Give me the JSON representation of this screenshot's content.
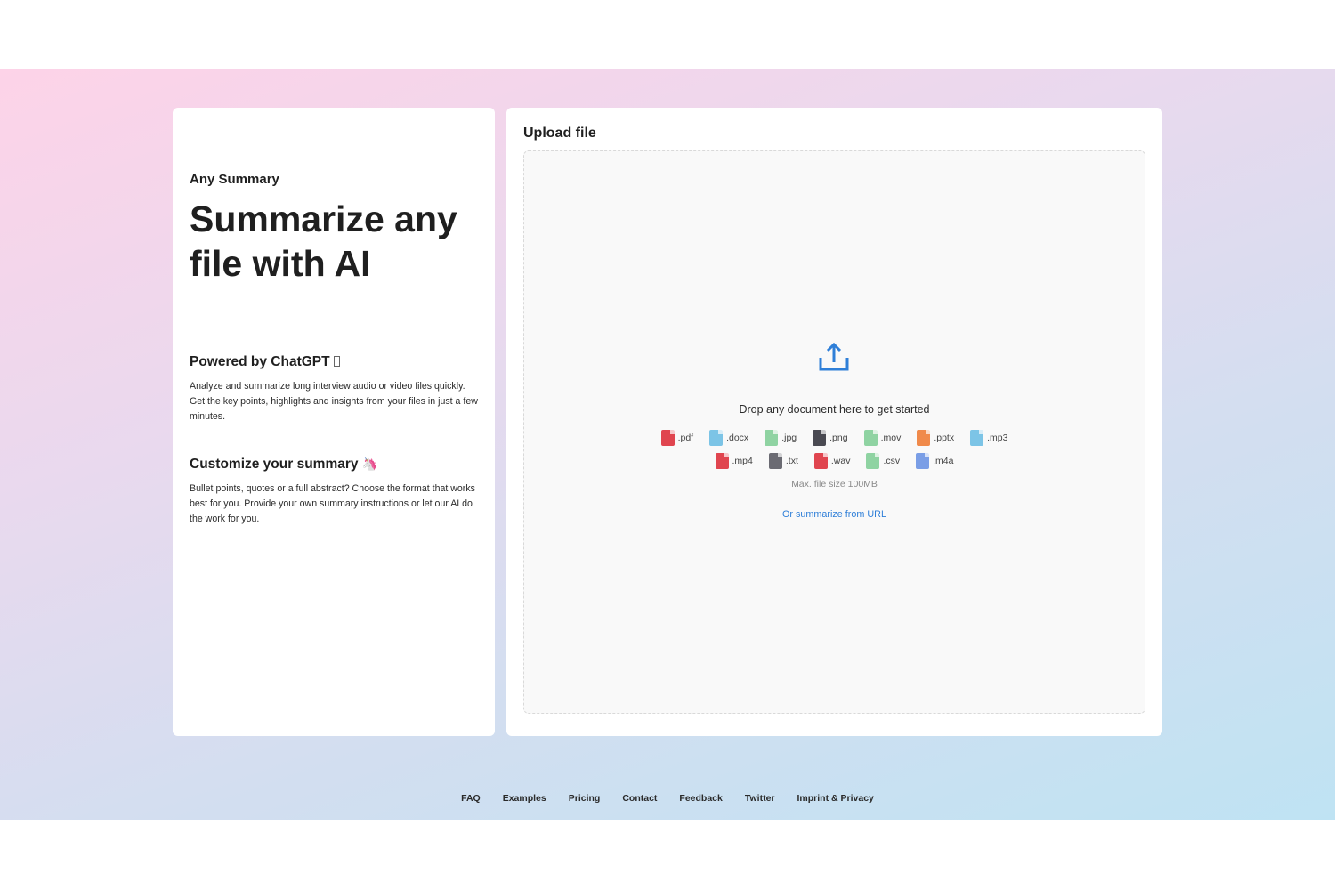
{
  "left_panel": {
    "brand": "Any Summary",
    "headline": "Summarize any file with AI",
    "section1_title": "Powered by ChatGPT",
    "section1_text": "Analyze and summarize long interview audio or video files quickly. Get the key points, highlights and insights from your files in just a few minutes.",
    "section2_title": "Customize your summary",
    "section2_text": "Bullet points, quotes or a full abstract? Choose the format that works best for you. Provide your own summary instructions or let our AI do the work for you."
  },
  "upload": {
    "title": "Upload file",
    "drop_text": "Drop any document here to get started",
    "file_types_row1": [
      {
        "ext": ".pdf",
        "color": "#e0454f"
      },
      {
        "ext": ".docx",
        "color": "#7cc4e6"
      },
      {
        "ext": ".jpg",
        "color": "#8fd3a2"
      },
      {
        "ext": ".png",
        "color": "#4a4a52"
      },
      {
        "ext": ".mov",
        "color": "#8fd3a2"
      },
      {
        "ext": ".pptx",
        "color": "#f08a4b"
      },
      {
        "ext": ".mp3",
        "color": "#7cc4e6"
      }
    ],
    "file_types_row2": [
      {
        "ext": ".mp4",
        "color": "#e0454f"
      },
      {
        "ext": ".txt",
        "color": "#6b6b73"
      },
      {
        "ext": ".wav",
        "color": "#e0454f"
      },
      {
        "ext": ".csv",
        "color": "#8fd3a2"
      },
      {
        "ext": ".m4a",
        "color": "#7a9ee6"
      }
    ],
    "max_size": "Max. file size 100MB",
    "url_link": "Or summarize from URL",
    "accent_color": "#2f7fd8"
  },
  "footer": {
    "links": [
      "FAQ",
      "Examples",
      "Pricing",
      "Contact",
      "Feedback",
      "Twitter",
      "Imprint & Privacy"
    ]
  }
}
